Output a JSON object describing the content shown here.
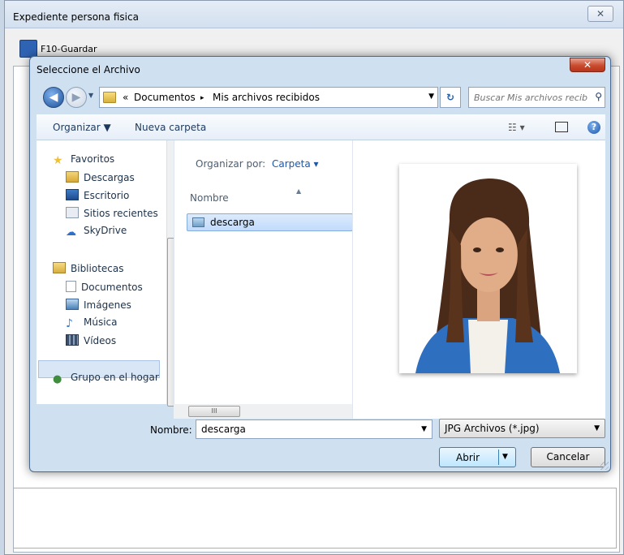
{
  "parent_window": {
    "title": "Expediente persona fisica",
    "close_label": "✕",
    "save_label": "F10-Guardar"
  },
  "dialog": {
    "title": "Seleccione el Archivo",
    "close_label": "✕",
    "nav": {
      "back_glyph": "◀",
      "forward_glyph": "▶",
      "history_glyph": "▼",
      "breadcrumb_overflow": "«",
      "breadcrumb": [
        "Documentos",
        "Mis archivos recibidos"
      ],
      "breadcrumb_sep": "▸",
      "refresh_glyph": "↻",
      "search_placeholder": "Buscar Mis archivos recibidos"
    },
    "toolbar": {
      "organize_label": "Organizar ▼",
      "new_folder_label": "Nueva carpeta",
      "view_label": "☷ ▾",
      "help_label": "?"
    },
    "sidebar": {
      "items": [
        {
          "label": "Favoritos",
          "icon": "star-icon",
          "color": "#f2c12e"
        },
        {
          "label": "Descargas",
          "icon": "downloads-icon",
          "color": "#3b6fb6"
        },
        {
          "label": "Escritorio",
          "icon": "desktop-icon",
          "color": "#2a5fa3"
        },
        {
          "label": "Sitios recientes",
          "icon": "recent-places-icon",
          "color": "#8b9bb0"
        },
        {
          "label": "SkyDrive",
          "icon": "cloud-icon",
          "color": "#2f6fc7"
        },
        {
          "label": "Bibliotecas",
          "icon": "libraries-icon",
          "color": "#e2b94a"
        },
        {
          "label": "Documentos",
          "icon": "documents-icon",
          "color": "#cfd8e3"
        },
        {
          "label": "Imágenes",
          "icon": "pictures-icon",
          "color": "#4a7fb8"
        },
        {
          "label": "Música",
          "icon": "music-icon",
          "color": "#3a7ed0"
        },
        {
          "label": "Vídeos",
          "icon": "videos-icon",
          "color": "#3b4f6a"
        },
        {
          "label": "Grupo en el hogar",
          "icon": "homegroup-icon",
          "color": "#3e8e3e"
        }
      ]
    },
    "file_list": {
      "arrange_by_label": "Organizar por:",
      "arrange_by_value": "Carpeta ▾",
      "column_header": "Nombre",
      "files": [
        {
          "name": "descarga",
          "icon": "image-file-icon"
        }
      ]
    },
    "scroll_thumb_glyph": "III",
    "bottom": {
      "name_label": "Nombre:",
      "name_value": "descarga",
      "file_type": "JPG Archivos (*.jpg)",
      "open_label": "Abrir",
      "cancel_label": "Cancelar"
    },
    "accent_color": "#3c7fb1"
  }
}
